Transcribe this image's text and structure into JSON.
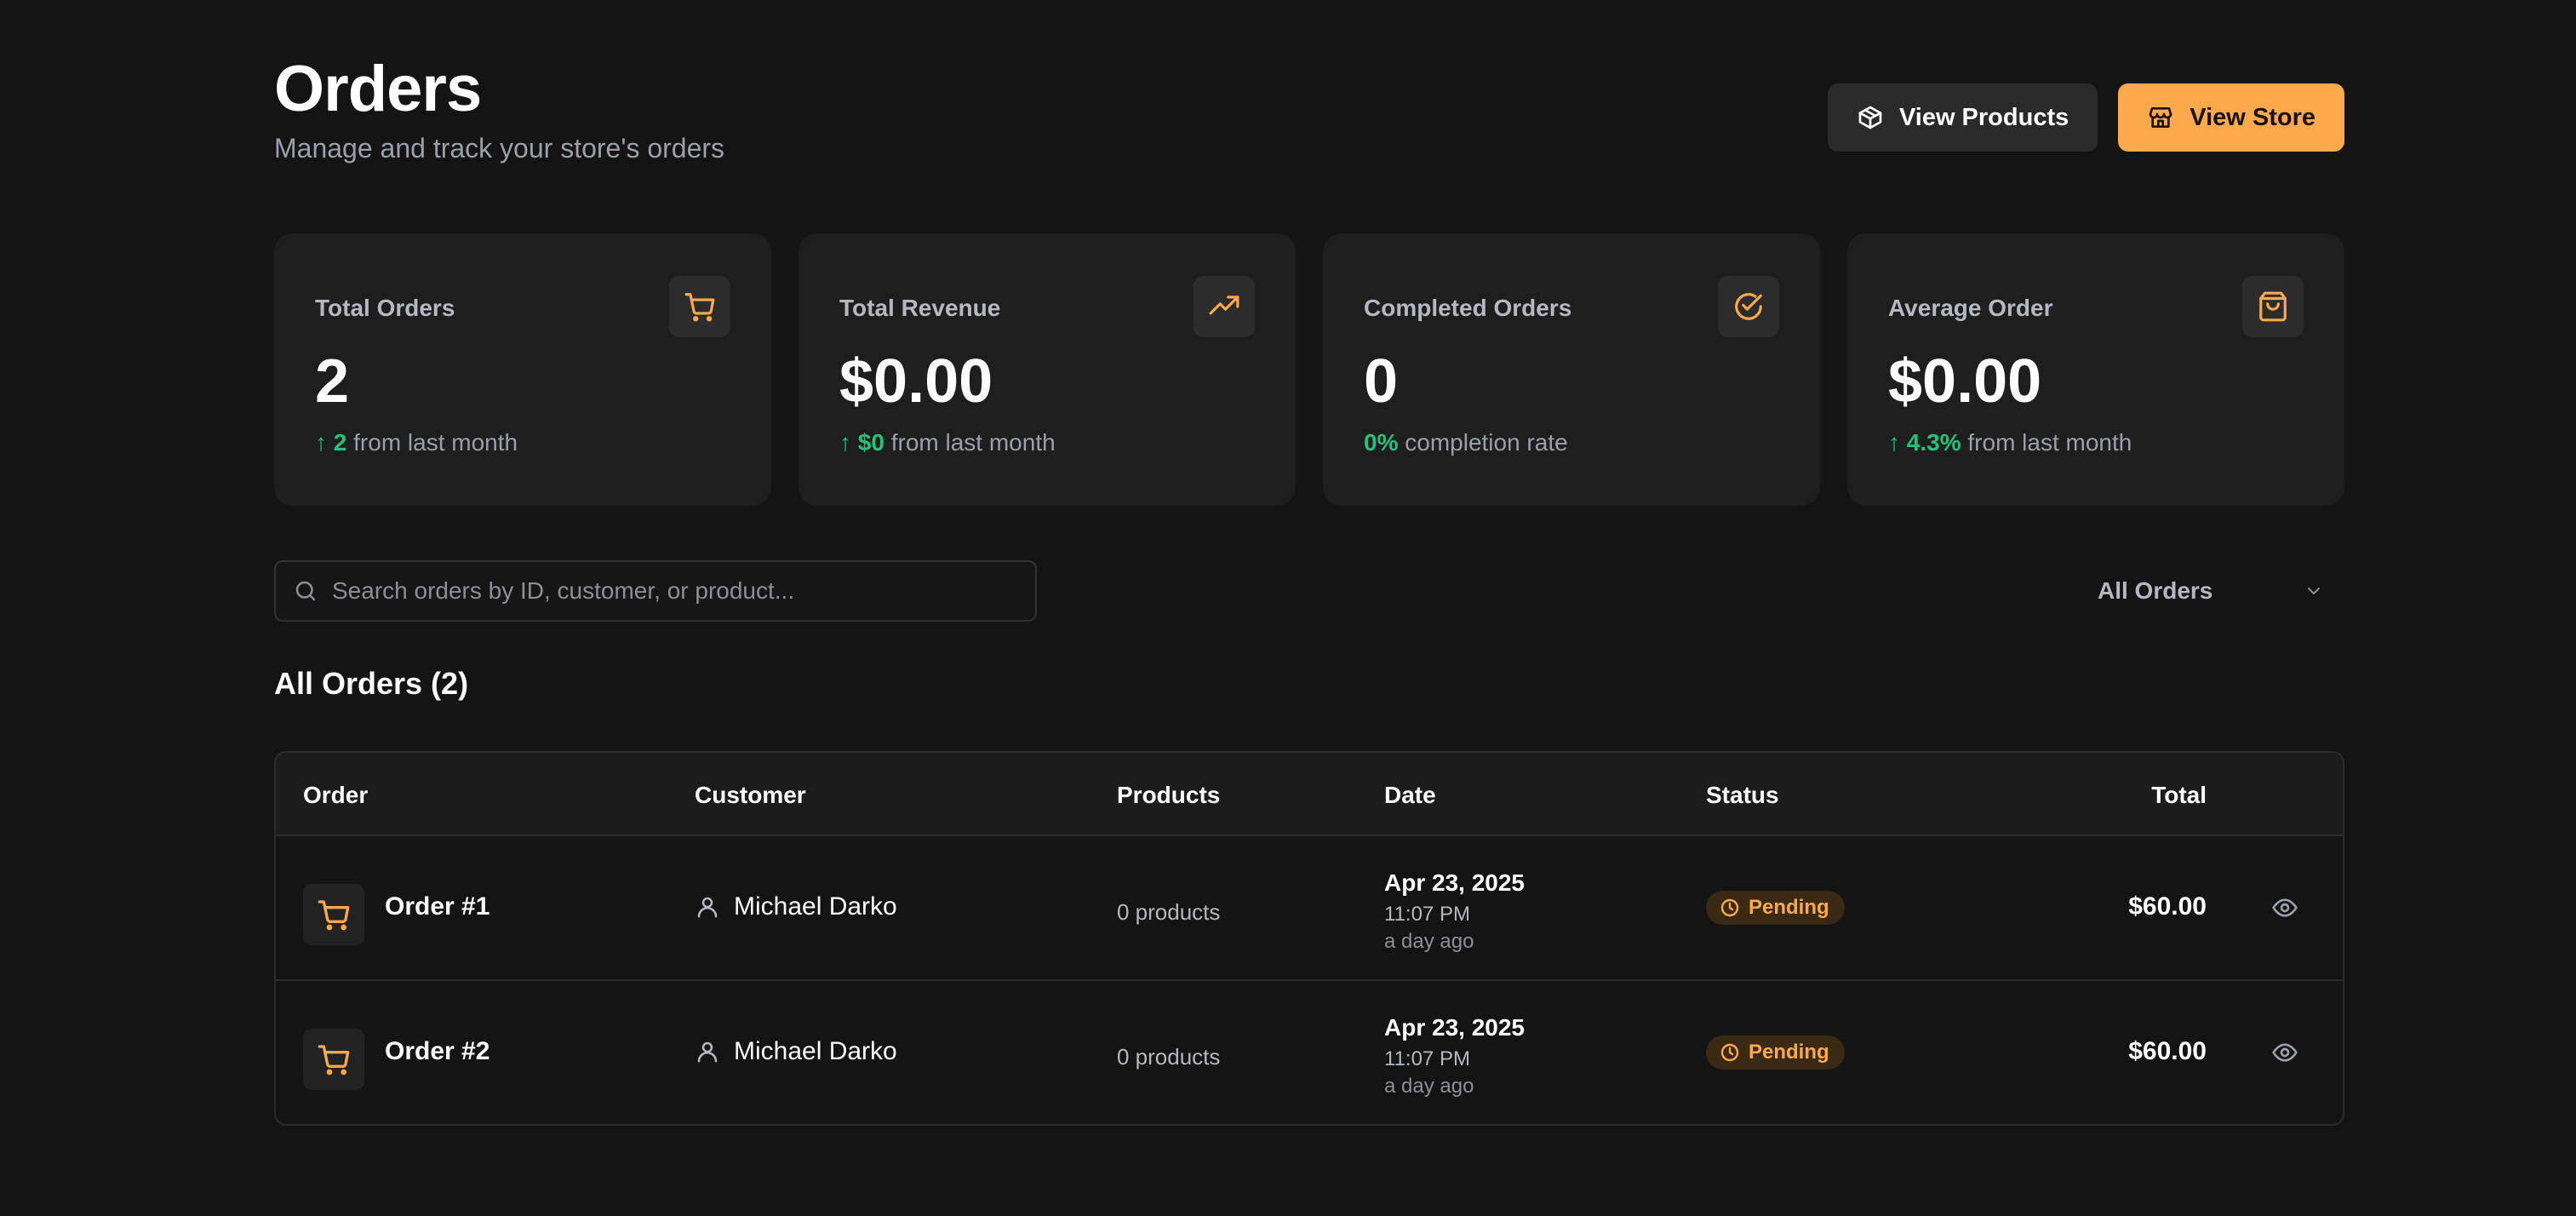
{
  "header": {
    "title": "Orders",
    "subtitle": "Manage and track your store's orders",
    "view_products_label": "View Products",
    "view_store_label": "View Store"
  },
  "stats": [
    {
      "label": "Total Orders",
      "value": "2",
      "delta": "↑ 2",
      "foot": " from last month",
      "icon": "cart-icon"
    },
    {
      "label": "Total Revenue",
      "value": "$0.00",
      "delta": "↑ $0",
      "foot": " from last month",
      "icon": "trending-up-icon"
    },
    {
      "label": "Completed Orders",
      "value": "0",
      "delta": "0%",
      "foot": " completion rate",
      "icon": "check-circle-icon"
    },
    {
      "label": "Average Order",
      "value": "$0.00",
      "delta": "↑ 4.3%",
      "foot": " from last month",
      "icon": "shopping-bag-icon"
    }
  ],
  "search": {
    "placeholder": "Search orders by ID, customer, or product..."
  },
  "filter": {
    "selected": "All Orders"
  },
  "section_title": "All Orders (2)",
  "table": {
    "headers": {
      "order": "Order",
      "customer": "Customer",
      "products": "Products",
      "date": "Date",
      "status": "Status",
      "total": "Total"
    },
    "rows": [
      {
        "order": "Order #1",
        "customer": "Michael Darko",
        "products": "0 products",
        "date": "Apr 23, 2025",
        "time": "11:07 PM",
        "relative": "a day ago",
        "status": "Pending",
        "total": "$60.00"
      },
      {
        "order": "Order #2",
        "customer": "Michael Darko",
        "products": "0 products",
        "date": "Apr 23, 2025",
        "time": "11:07 PM",
        "relative": "a day ago",
        "status": "Pending",
        "total": "$60.00"
      }
    ]
  },
  "colors": {
    "accent": "#ffa94d",
    "positive": "#22c47a",
    "background": "#141414",
    "card": "#1e1e1e"
  }
}
